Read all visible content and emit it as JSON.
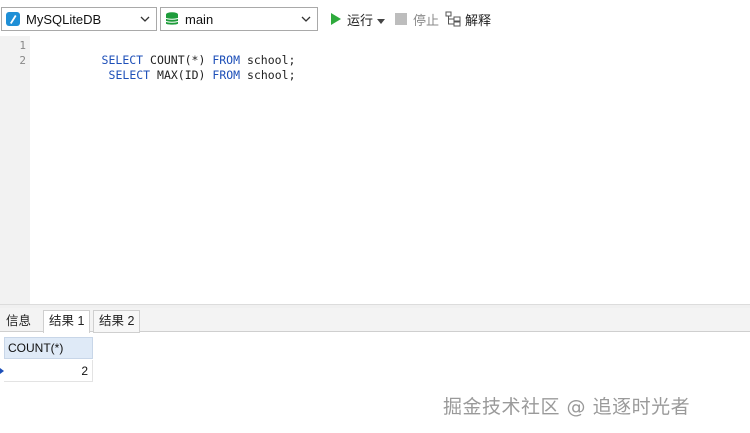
{
  "toolbar": {
    "connection": "MySQLiteDB",
    "schema": "main",
    "run_label": "运行",
    "stop_label": "停止",
    "explain_label": "解释"
  },
  "editor": {
    "lines": [
      {
        "number": "1",
        "parts": [
          {
            "k": "kw",
            "t": "SELECT "
          },
          {
            "k": "tx",
            "t": "COUNT(*) "
          },
          {
            "k": "kw",
            "t": "FROM "
          },
          {
            "k": "tx",
            "t": "school;"
          }
        ]
      },
      {
        "number": "2",
        "parts": [
          {
            "k": "kw",
            "t": "SELECT "
          },
          {
            "k": "tx",
            "t": "MAX(ID) "
          },
          {
            "k": "kw",
            "t": "FROM "
          },
          {
            "k": "tx",
            "t": "school;"
          }
        ]
      }
    ]
  },
  "result_tabs": {
    "info": "信息",
    "result1": "结果 1",
    "result2": "结果 2"
  },
  "result_grid": {
    "columns": [
      "COUNT(*)"
    ],
    "rows": [
      [
        "2"
      ]
    ]
  },
  "watermark": "掘金技术社区 @ 追逐时光者",
  "colors": {
    "keyword": "#1d4fb8",
    "run_green": "#2eaa3c",
    "db_green": "#1e9c3b",
    "header_blue": "#dfeaf7"
  }
}
